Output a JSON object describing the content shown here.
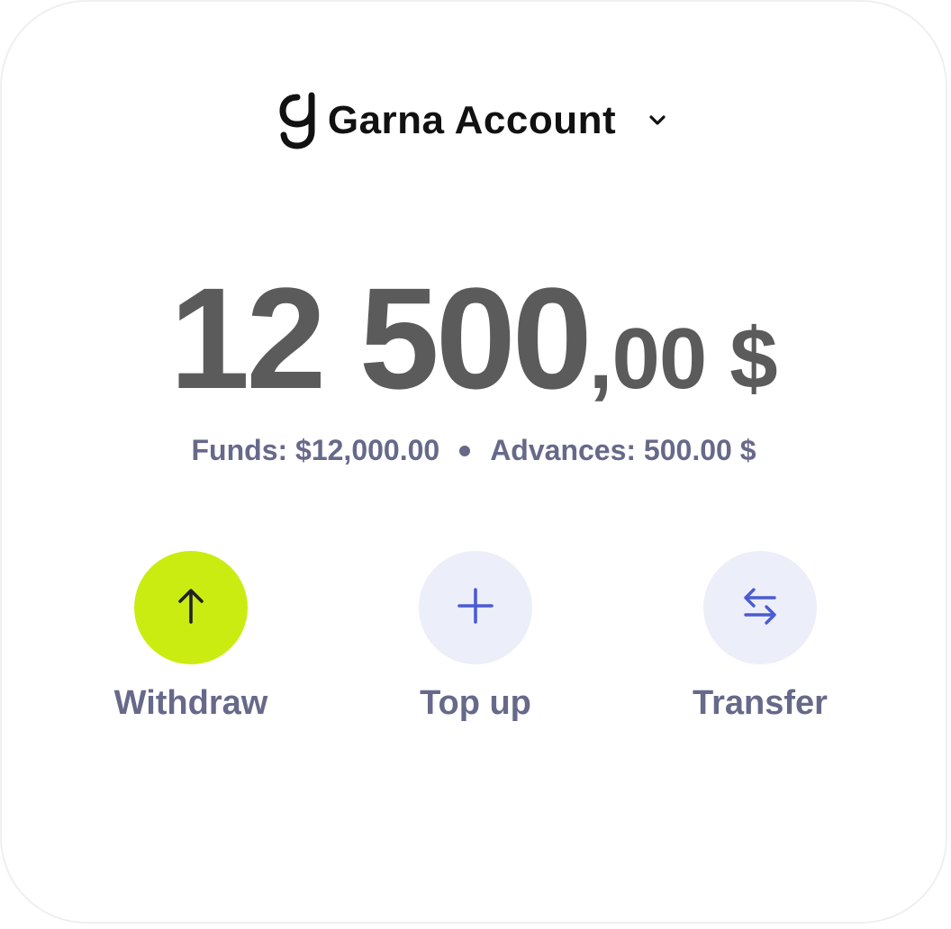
{
  "header": {
    "account_name": "Garna Account",
    "logo_icon": "garna-g-logo-icon",
    "dropdown_icon": "chevron-down-icon"
  },
  "balance": {
    "whole": "12 500",
    "cents": ",00",
    "currency": "$"
  },
  "breakdown": {
    "funds": "Funds: $12,000.00",
    "advances": "Advances: 500.00 $"
  },
  "actions": [
    {
      "label": "Withdraw",
      "icon": "arrow-up-icon",
      "style": "primary",
      "color": "#CBEC11"
    },
    {
      "label": "Top up",
      "icon": "plus-icon",
      "style": "secondary",
      "color": "#ECEEF9"
    },
    {
      "label": "Transfer",
      "icon": "transfer-arrows-icon",
      "style": "secondary",
      "color": "#ECEEF9"
    }
  ],
  "colors": {
    "accent": "#CBEC11",
    "icon_blue": "#4A5BD4",
    "text_muted": "#67698A",
    "balance_text": "#5B5B5B"
  }
}
